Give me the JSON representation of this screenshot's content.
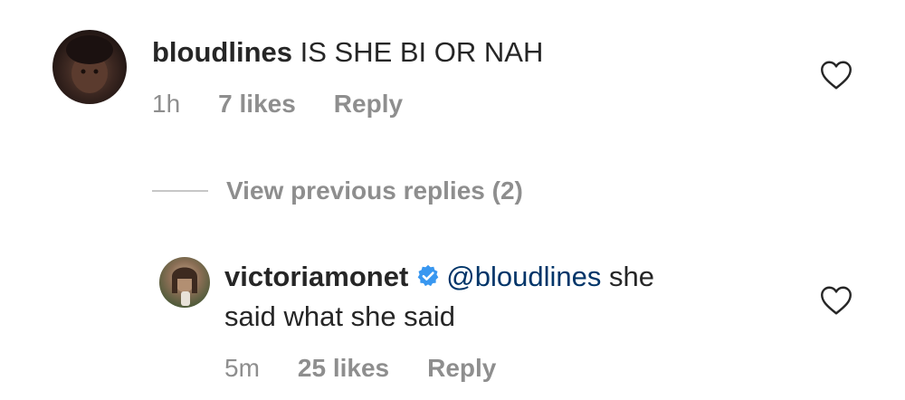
{
  "comments": [
    {
      "username": "bloudlines",
      "text": "IS SHE BI OR NAH",
      "time": "1h",
      "likes": "7 likes",
      "reply_label": "Reply"
    },
    {
      "username": "victoriamonet",
      "mention": "@bloudlines",
      "text_line1": "she",
      "text_line2": "said what she said",
      "time": "5m",
      "likes": "25 likes",
      "reply_label": "Reply"
    }
  ],
  "view_previous_replies": "View previous replies (2)",
  "icons": {
    "like": "heart-outline-icon",
    "verified": "verified-badge-icon"
  },
  "colors": {
    "text": "#262626",
    "meta": "#8e8e8e",
    "mention": "#003569",
    "verified": "#3897f0"
  }
}
